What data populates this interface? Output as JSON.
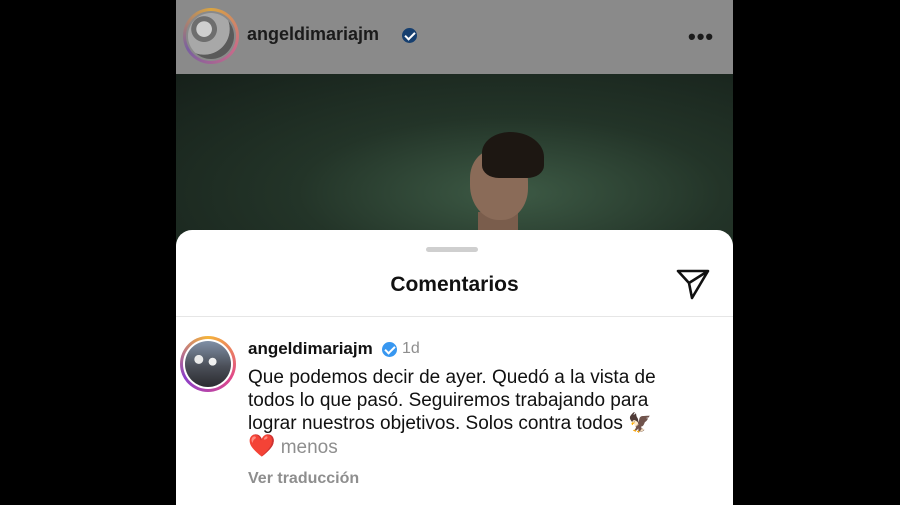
{
  "post": {
    "username": "angeldimariajm",
    "more_icon": "more-horizontal-icon",
    "more_glyph": "•••"
  },
  "sheet": {
    "title": "Comentarios",
    "share_icon": "paper-plane-icon"
  },
  "comment": {
    "username": "angeldimariajm",
    "time": "1d",
    "line1": "Que podemos decir de ayer. Quedó a la vista de",
    "line2": "todos lo que pasó. Seguiremos trabajando para",
    "line3": "lograr nuestros objetivos. Solos contra todos",
    "eagle_emoji": "🦅",
    "heart_emoji": "❤️",
    "less_label": "menos",
    "translate_label": "Ver traducción"
  },
  "colors": {
    "verified_blue": "#3897f0",
    "heart_red": "#e0243a",
    "secondary_text": "#8e8e8e"
  }
}
